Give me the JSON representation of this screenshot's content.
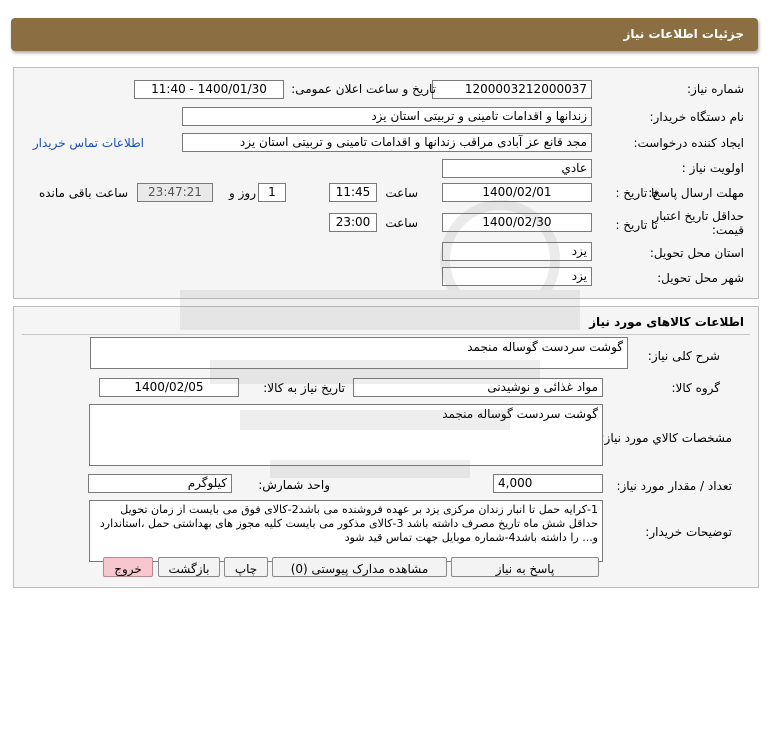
{
  "page": {
    "title": "جزئیات اطلاعات نیاز"
  },
  "details": {
    "need_number_label": "شماره نیاز:",
    "need_number": "1200003212000037",
    "announce_label": "تاریخ و ساعت اعلان عمومی:",
    "announce_value": "1400/01/30 - 11:40",
    "buyer_label": "نام دستگاه خریدار:",
    "buyer_value": "زندانها و اقدامات تامینی و تربیتی استان یزد",
    "requester_label": "ایجاد کننده درخواست:",
    "requester_value": "مجد قانع عز آبادی  مراقب زندانها و اقدامات تامینی و تربیتی استان یزد",
    "contact_link": "اطلاعات تماس خریدار",
    "priority_label": "اولویت نیاز :",
    "priority_value": "عادي",
    "deadline_label": "مهلت ارسال پاسخ:",
    "until_date_label": "تا تاریخ :",
    "deadline_date": "1400/02/01",
    "time_label": "ساعت",
    "deadline_time": "11:45",
    "days_value": "1",
    "days_label": "روز و",
    "remaining_time": "23:47:21",
    "remaining_label": "ساعت باقی مانده",
    "min_validity_label_1": "حداقل تاریخ اعتبار",
    "min_validity_label_2": "قیمت:",
    "validity_date": "1400/02/30",
    "validity_time": "23:00",
    "province_label": "استان محل تحویل:",
    "province_value": "یزد",
    "city_label": "شهر محل تحویل:",
    "city_value": "یزد"
  },
  "goods": {
    "section_title": "اطلاعات کالاهای مورد نیاز",
    "general_desc_label": "شرح کلی نیاز:",
    "general_desc": "گوشت سردست گوساله منجمد",
    "group_label": "گروه کالا:",
    "group_value": "مواد غذائی و نوشیدنی",
    "need_date_label": "تاریخ نیاز به کالا:",
    "need_date": "1400/02/05",
    "specs_label": "مشخصات کالاي مورد نياز:",
    "specs_value": "گوشت سردست گوساله منجمد",
    "quantity_label": "تعداد / مقدار مورد نیاز:",
    "quantity_value": "4,000",
    "unit_label": "واحد شمارش:",
    "unit_value": "کیلوگرم",
    "buyer_notes_label": "توضیحات خریدار:",
    "buyer_notes": "1-کرایه حمل تا انبار زندان مرکزی یزد بر عهده فروشنده می باشد2-کالای فوق می بایست از زمان تحویل حداقل شش ماه تاریخ مصرف داشته باشد 3-کالای مذکور می بایست کلیه مجوز های بهداشتی حمل ،استاندارد و... را داشته باشد4-شماره موبایل جهت تماس قید شود"
  },
  "buttons": {
    "reply": "پاسخ به نیاز",
    "attachments": "مشاهده مدارک پیوستی (0)",
    "print": "چاپ",
    "back": "بازگشت",
    "exit": "خروج"
  },
  "colors": {
    "title_bar": "#8b6f43",
    "link": "#1a4fb4",
    "exit_button": "#f7c6cf"
  }
}
